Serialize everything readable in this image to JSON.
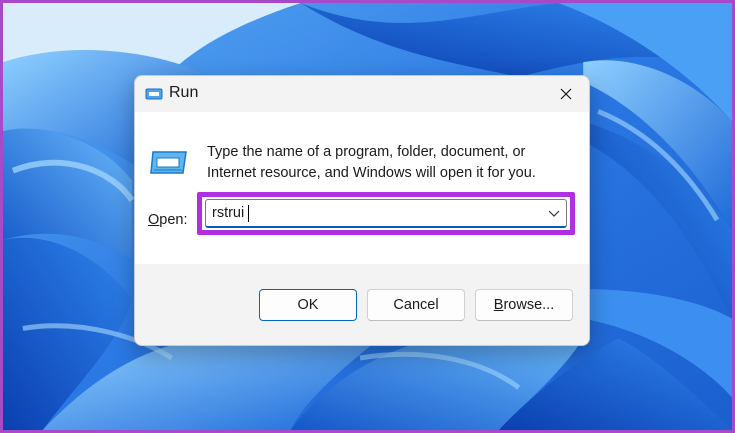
{
  "dialog": {
    "title": "Run",
    "close_icon": "close-icon",
    "app_icon": "run-icon",
    "description_line1": "Type the name of a program, folder, document, or",
    "description_line2": "Internet resource, and Windows will open it for you.",
    "open_label_prefix": "O",
    "open_label_rest": "pen:",
    "open_value": "rstrui",
    "dropdown_icon": "chevron-down-icon"
  },
  "buttons": {
    "ok": "OK",
    "cancel": "Cancel",
    "browse_prefix": "B",
    "browse_rest": "rowse..."
  },
  "colors": {
    "highlight": "#b12fe3",
    "screen_border": "#a64ac9",
    "accent": "#0067c0"
  }
}
